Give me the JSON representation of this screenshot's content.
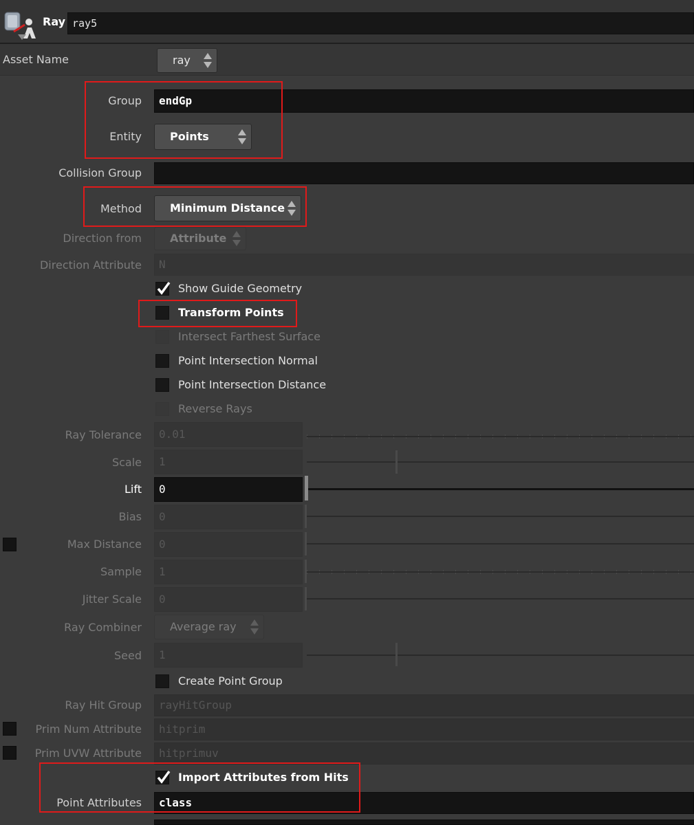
{
  "header": {
    "node_type": "Ray",
    "node_name": "ray5",
    "icon": "ray-node-icon"
  },
  "asset_name": {
    "label": "Asset Name",
    "value": "ray"
  },
  "params": {
    "group": {
      "label": "Group",
      "value": "endGp"
    },
    "entity": {
      "label": "Entity",
      "value": "Points"
    },
    "collision_group": {
      "label": "Collision Group",
      "value": ""
    },
    "method": {
      "label": "Method",
      "value": "Minimum Distance"
    },
    "direction_from": {
      "label": "Direction from",
      "value": "Attribute"
    },
    "direction_attribute": {
      "label": "Direction Attribute",
      "value": "N"
    },
    "show_guide_geometry": {
      "label": "Show Guide Geometry",
      "checked": true
    },
    "transform_points": {
      "label": "Transform Points",
      "checked": false
    },
    "intersect_farthest_surface": {
      "label": "Intersect Farthest Surface",
      "checked": false
    },
    "point_intersection_normal": {
      "label": "Point Intersection Normal",
      "checked": false
    },
    "point_intersection_distance": {
      "label": "Point Intersection Distance",
      "checked": false
    },
    "reverse_rays": {
      "label": "Reverse Rays",
      "checked": false
    },
    "ray_tolerance": {
      "label": "Ray Tolerance",
      "value": "0.01"
    },
    "scale": {
      "label": "Scale",
      "value": "1"
    },
    "lift": {
      "label": "Lift",
      "value": "0"
    },
    "bias": {
      "label": "Bias",
      "value": "0"
    },
    "max_distance": {
      "label": "Max Distance",
      "value": "0",
      "enabled": false
    },
    "sample": {
      "label": "Sample",
      "value": "1"
    },
    "jitter_scale": {
      "label": "Jitter Scale",
      "value": "0"
    },
    "ray_combiner": {
      "label": "Ray Combiner",
      "value": "Average ray"
    },
    "seed": {
      "label": "Seed",
      "value": "1"
    },
    "create_point_group": {
      "label": "Create Point Group",
      "checked": false
    },
    "ray_hit_group": {
      "label": "Ray Hit Group",
      "value": "rayHitGroup"
    },
    "prim_num_attribute": {
      "label": "Prim Num Attribute",
      "value": "hitprim",
      "enabled": false
    },
    "prim_uvw_attribute": {
      "label": "Prim UVW Attribute",
      "value": "hitprimuv",
      "enabled": false
    },
    "import_attributes_from_hits": {
      "label": "Import Attributes from Hits",
      "checked": true
    },
    "point_attributes": {
      "label": "Point Attributes",
      "value": "class"
    }
  },
  "colors": {
    "highlight": "#e01a1a",
    "background": "#3b3b3b",
    "field": "#141414"
  }
}
